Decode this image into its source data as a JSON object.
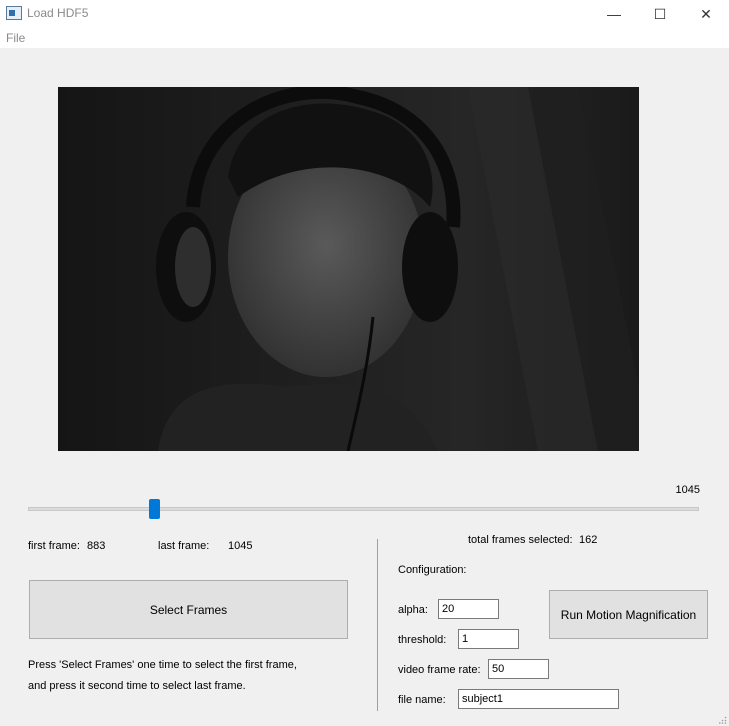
{
  "window": {
    "title": "Load HDF5",
    "minimize_glyph": "—",
    "maximize_glyph": "☐",
    "close_glyph": "✕",
    "icon": "app-window-icon"
  },
  "menu": {
    "file": "File"
  },
  "video": {
    "description_icon": "video-frame-preview"
  },
  "slider": {
    "current_value": "1045",
    "position_fraction": 0.18
  },
  "frames": {
    "first_label": "first frame:",
    "first_value": "883",
    "last_label": "last frame:",
    "last_value": "1045",
    "total_label": "total frames selected:",
    "total_value": "162"
  },
  "select_button": "Select Frames",
  "help_line1": "Press 'Select Frames' one time to select the first frame,",
  "help_line2": "and press it second time to select last frame.",
  "config": {
    "heading": "Configuration:",
    "alpha_label": "alpha:",
    "alpha_value": "20",
    "threshold_label": "threshold:",
    "threshold_value": "1",
    "frame_rate_label": "video frame rate:",
    "frame_rate_value": "50",
    "file_name_label": "file name:",
    "file_name_value": "subject1"
  },
  "run_button": "Run Motion Magnification",
  "colors": {
    "accent": "#0078d7",
    "button_bg": "#e1e1e1",
    "window_bg": "#f0f0f0"
  }
}
